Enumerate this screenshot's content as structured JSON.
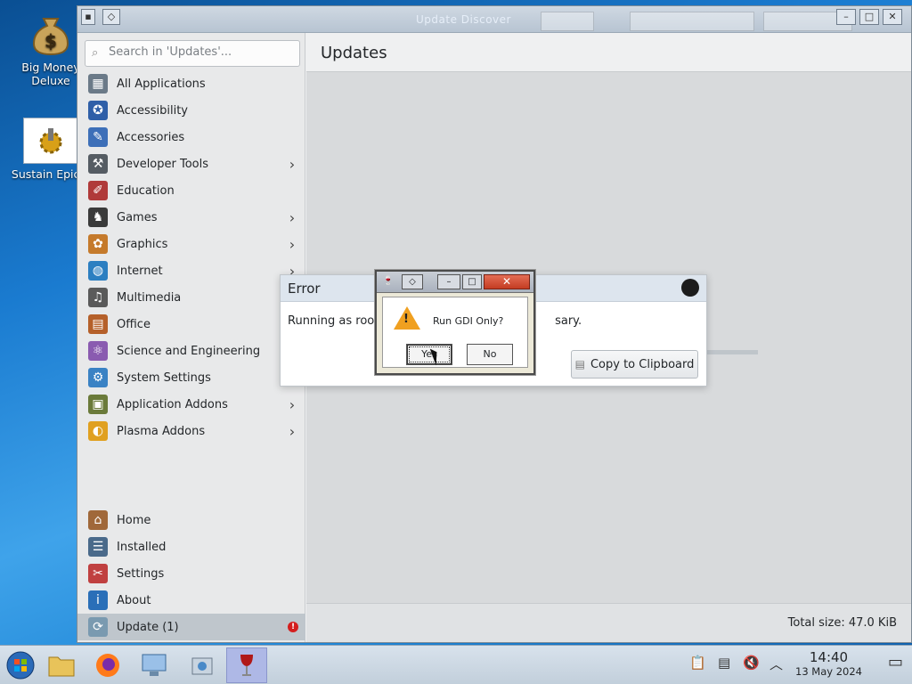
{
  "desktop": {
    "icons": [
      {
        "label": "Big Money Deluxe",
        "icon": "money-bag-icon"
      },
      {
        "label": "Sustain Epic.e",
        "icon": "gear-icon"
      }
    ]
  },
  "window": {
    "title_faint": "Update  Discover",
    "search": {
      "placeholder": "Search in 'Updates'..."
    },
    "page_title": "Updates",
    "categories": [
      {
        "label": "All Applications",
        "icon": "grid-icon",
        "color": "#6b7a88",
        "submenu": false
      },
      {
        "label": "Accessibility",
        "icon": "accessibility-icon",
        "color": "#2f5fa8",
        "submenu": false
      },
      {
        "label": "Accessories",
        "icon": "accessories-icon",
        "color": "#3d6fb8",
        "submenu": false
      },
      {
        "label": "Developer Tools",
        "icon": "developer-tools-icon",
        "color": "#555c63",
        "submenu": true
      },
      {
        "label": "Education",
        "icon": "education-icon",
        "color": "#b03a3a",
        "submenu": false
      },
      {
        "label": "Games",
        "icon": "games-icon",
        "color": "#3a3a3a",
        "submenu": true
      },
      {
        "label": "Graphics",
        "icon": "graphics-icon",
        "color": "#c57a2b",
        "submenu": true
      },
      {
        "label": "Internet",
        "icon": "internet-icon",
        "color": "#2c7fc1",
        "submenu": true
      },
      {
        "label": "Multimedia",
        "icon": "multimedia-icon",
        "color": "#5a5a5a",
        "submenu": false
      },
      {
        "label": "Office",
        "icon": "office-icon",
        "color": "#b5602a",
        "submenu": false
      },
      {
        "label": "Science and Engineering",
        "icon": "science-icon",
        "color": "#8a5bb0",
        "submenu": false
      },
      {
        "label": "System Settings",
        "icon": "system-settings-icon",
        "color": "#3a82c4",
        "submenu": false
      },
      {
        "label": "Application Addons",
        "icon": "application-addons-icon",
        "color": "#6a7a3a",
        "submenu": true
      },
      {
        "label": "Plasma Addons",
        "icon": "plasma-addons-icon",
        "color": "#e0a020",
        "submenu": true
      }
    ],
    "footer": [
      {
        "label": "Home",
        "icon": "home-icon",
        "color": "#a0683a"
      },
      {
        "label": "Installed",
        "icon": "installed-icon",
        "color": "#4a6a8a"
      },
      {
        "label": "Settings",
        "icon": "settings-icon",
        "color": "#c04040"
      },
      {
        "label": "About",
        "icon": "about-icon",
        "color": "#2a6fb8"
      },
      {
        "label": "Update (1)",
        "icon": "update-icon",
        "color": "#7a9ab0",
        "badge": "!"
      }
    ],
    "total_size": "Total size: 47.0 KiB"
  },
  "error_dialog": {
    "title": "Error",
    "message": "Running as root i",
    "message_tail": "sary.",
    "copy_button": "Copy to Clipboard"
  },
  "gdi_dialog": {
    "question": "Run GDI Only?",
    "yes": "Yes",
    "no": "No"
  },
  "taskbar": {
    "apps": [
      "start-orb-icon",
      "file-manager-icon",
      "firefox-icon",
      "control-panel-icon",
      "installer-icon",
      "wine-icon"
    ],
    "time": "14:40",
    "date": "13 May 2024"
  }
}
